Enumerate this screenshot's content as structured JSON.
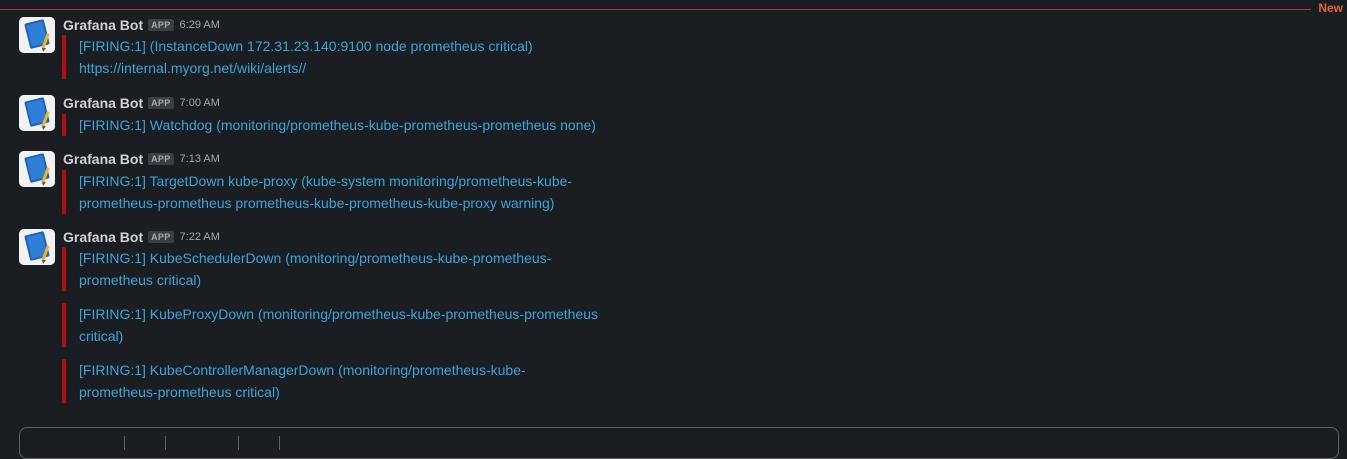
{
  "divider": {
    "label": "New",
    "color": "#c0392b"
  },
  "messages": [
    {
      "sender": "Grafana Bot",
      "badge": "APP",
      "time": "6:29 AM",
      "attachments": [
        {
          "line1": "[FIRING:1]  (InstanceDown 172.31.23.140:9100 node prometheus critical)",
          "line2": "https://internal.myorg.net/wiki/alerts//"
        }
      ]
    },
    {
      "sender": "Grafana Bot",
      "badge": "APP",
      "time": "7:00 AM",
      "attachments": [
        {
          "line1": "[FIRING:1] Watchdog (monitoring/prometheus-kube-prometheus-prometheus none)"
        }
      ]
    },
    {
      "sender": "Grafana Bot",
      "badge": "APP",
      "time": "7:13 AM",
      "attachments": [
        {
          "line1": "[FIRING:1] TargetDown kube-proxy (kube-system monitoring/prometheus-kube-",
          "line2": "prometheus-prometheus prometheus-kube-prometheus-kube-proxy warning)"
        }
      ]
    },
    {
      "sender": "Grafana Bot",
      "badge": "APP",
      "time": "7:22 AM",
      "attachments": [
        {
          "line1": "[FIRING:1] KubeSchedulerDown (monitoring/prometheus-kube-prometheus-",
          "line2": "prometheus critical)"
        },
        {
          "line1": "[FIRING:1] KubeProxyDown (monitoring/prometheus-kube-prometheus-prometheus",
          "line2": "critical)"
        },
        {
          "line1": "[FIRING:1] KubeControllerManagerDown (monitoring/prometheus-kube-",
          "line2": "prometheus-prometheus critical)"
        }
      ]
    }
  ],
  "colors": {
    "link": "#3aa5d8",
    "alert_bar": "#b00f0f",
    "background": "#1a1d21"
  },
  "icons": {
    "avatar": "grafana-bot-notebook-icon"
  }
}
